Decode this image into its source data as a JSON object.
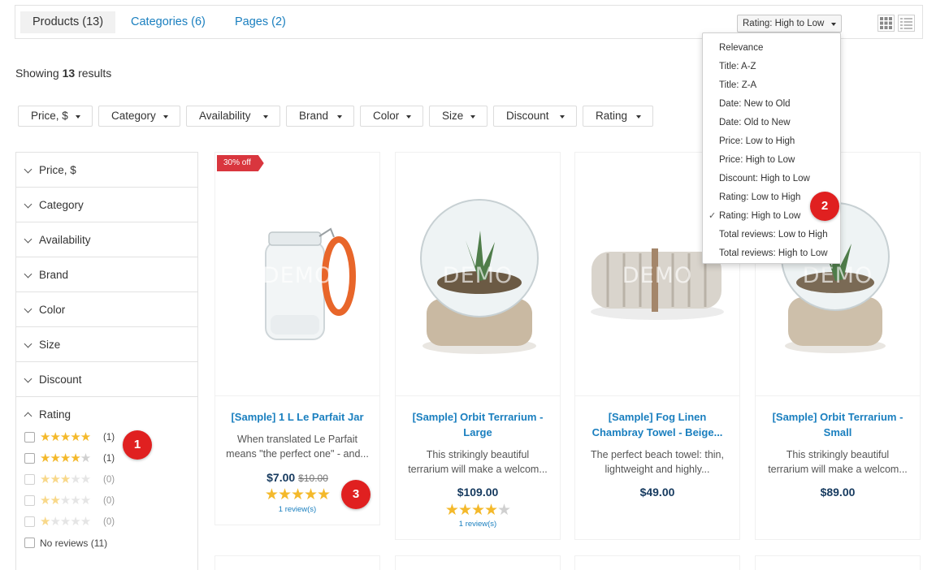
{
  "tabs": [
    {
      "label": "Products (13)",
      "active": true
    },
    {
      "label": "Categories (6)",
      "active": false
    },
    {
      "label": "Pages (2)",
      "active": false
    }
  ],
  "sort": {
    "selected": "Rating: High to Low",
    "options": [
      "Relevance",
      "Title: A-Z",
      "Title: Z-A",
      "Date: New to Old",
      "Date: Old to New",
      "Price: Low to High",
      "Price: High to Low",
      "Discount: High to Low",
      "Rating: Low to High",
      "Rating: High to Low",
      "Total reviews: Low to High",
      "Total reviews: High to Low"
    ],
    "checked_index": 9
  },
  "view_buttons": {
    "grid_icon": "grid-icon",
    "list_icon": "list-icon"
  },
  "results": {
    "prefix": "Showing",
    "count": "13",
    "suffix": "results"
  },
  "filter_chips": [
    "Price, $",
    "Category",
    "Availability",
    "Brand",
    "Color",
    "Size",
    "Discount",
    "Rating"
  ],
  "facets": [
    "Price, $",
    "Category",
    "Availability",
    "Brand",
    "Color",
    "Size",
    "Discount"
  ],
  "rating_facet": {
    "label": "Rating",
    "rows": [
      {
        "stars": 5,
        "count": "(1)"
      },
      {
        "stars": 4,
        "count": "(1)"
      },
      {
        "stars": 3,
        "count": "(0)"
      },
      {
        "stars": 2,
        "count": "(0)"
      },
      {
        "stars": 1,
        "count": "(0)"
      }
    ],
    "no_reviews": "No reviews",
    "no_reviews_count": "(11)"
  },
  "products": [
    {
      "badge": "30% off",
      "title": "[Sample] 1 L Le Parfait Jar",
      "desc": "When translated Le Parfait means \"the perfect one\" - and...",
      "price": "$7.00",
      "old_price": "$10.00",
      "rating": 5,
      "reviews": "1 review(s)",
      "watermark": "DEMO"
    },
    {
      "title": "[Sample] Orbit Terrarium - Large",
      "desc": "This strikingly beautiful terrarium will make a welcom...",
      "price": "$109.00",
      "rating": 4,
      "reviews": "1 review(s)",
      "watermark": "DEMO"
    },
    {
      "title": "[Sample] Fog Linen Chambray Towel - Beige...",
      "desc": "The perfect beach towel: thin, lightweight and highly...",
      "price": "$49.00",
      "watermark": "DEMO"
    },
    {
      "title": "[Sample] Orbit Terrarium - Small",
      "desc": "This strikingly beautiful terrarium will make a welcom...",
      "price": "$89.00",
      "watermark": "DEMO"
    }
  ],
  "markers": [
    "1",
    "2",
    "3"
  ],
  "colors": {
    "link": "#1a7fbf",
    "price": "#163a5f",
    "badge": "#d9363e",
    "star": "#f4b92b",
    "marker": "#e02020"
  }
}
